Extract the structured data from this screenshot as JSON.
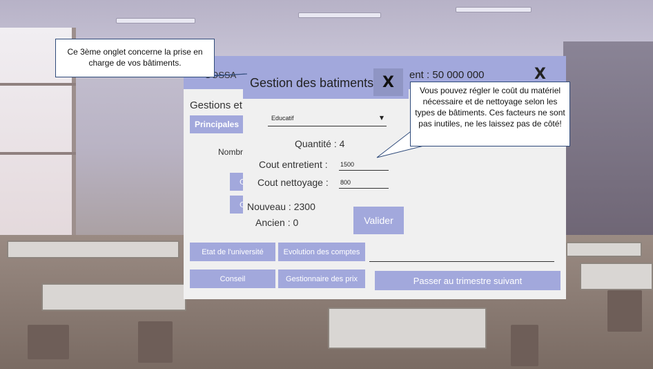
{
  "app": {
    "title_fragment": "GOSSA",
    "money_fragment": "ent : 50 000 000",
    "close_label": "X",
    "gestions_fragment": "Gestions et c",
    "principales_tab": "Principales",
    "nombre_fragment": "Nombre",
    "small_btn_1": "C",
    "small_btn_2": "C",
    "nav": {
      "etat": "Etat de l'université",
      "evolution": "Evolution des comptes",
      "conseil": "Conseil",
      "gestionnaire": "Gestionnaire des prix",
      "passer": "Passer au trimestre suivant"
    }
  },
  "modal": {
    "title": "Gestion des batiments",
    "close_label": "X",
    "building_type": "Educatif",
    "quantite": "Quantité : 4",
    "cout_entretien_label": "Cout entretient :",
    "cout_entretien_value": "1500",
    "cout_nettoyage_label": "Cout nettoyage :",
    "cout_nettoyage_value": "800",
    "nouveau": "Nouveau : 2300",
    "ancien": "Ancien : 0",
    "valider": "Valider"
  },
  "callouts": {
    "left": "Ce 3ème onglet concerne la prise en charge de vos bâtiments.",
    "right": "Vous pouvez régler le coût du matériel nécessaire et de nettoyage selon les types de bâtiments. Ces facteurs ne sont pas inutiles, ne les laissez pas de côté!"
  },
  "colors": {
    "accent": "#a2a8dc",
    "accent_dark": "#8f95c4",
    "panel_bg": "#f0f0f0",
    "callout_border": "#2e4a7a"
  }
}
